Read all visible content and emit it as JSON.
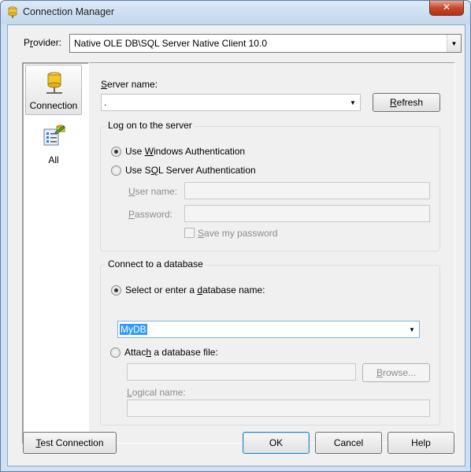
{
  "window": {
    "title": "Connection Manager",
    "close_glyph": "✕"
  },
  "provider": {
    "label_pre": "P",
    "label_u": "r",
    "label_post": "ovider:",
    "value": "Native OLE DB\\SQL Server Native Client 10.0"
  },
  "nav": {
    "items": [
      {
        "label": "Connection",
        "icon": "database-icon",
        "selected": true
      },
      {
        "label": "All",
        "icon": "properties-icon",
        "selected": false
      }
    ]
  },
  "server": {
    "label_u": "S",
    "label_post": "erver name:",
    "value": ".",
    "refresh_u": "R",
    "refresh_post": "efresh"
  },
  "logon": {
    "title": "Log on to the server",
    "windows_auth": {
      "pre": "Use ",
      "u": "W",
      "post": "indows Authentication",
      "checked": true
    },
    "sql_auth": {
      "pre": "Use S",
      "u": "Q",
      "post": "L Server Authentication",
      "checked": false
    },
    "username_label": {
      "u": "U",
      "post": "ser name:"
    },
    "password_label": {
      "u": "P",
      "post": "assword:"
    },
    "save_password": {
      "u": "S",
      "post": "ave my password",
      "checked": false
    }
  },
  "database": {
    "title": "Connect to a database",
    "select_option": {
      "pre": "Select or enter a ",
      "u": "d",
      "post": "atabase name:",
      "checked": true
    },
    "db_value": "MyDB",
    "attach_option": {
      "pre": "Attac",
      "u": "h",
      "post": " a database file:",
      "checked": false
    },
    "browse": {
      "u": "B",
      "post": "rowse..."
    },
    "logical_label": {
      "u": "L",
      "post": "ogical name:"
    }
  },
  "footer": {
    "test": {
      "u": "T",
      "post": "est Connection"
    },
    "ok": "OK",
    "cancel": "Cancel",
    "help": "Help"
  },
  "colors": {
    "title_bg": "#c3d7ee",
    "selection": "#3399ff",
    "close_button": "#c7472a"
  }
}
